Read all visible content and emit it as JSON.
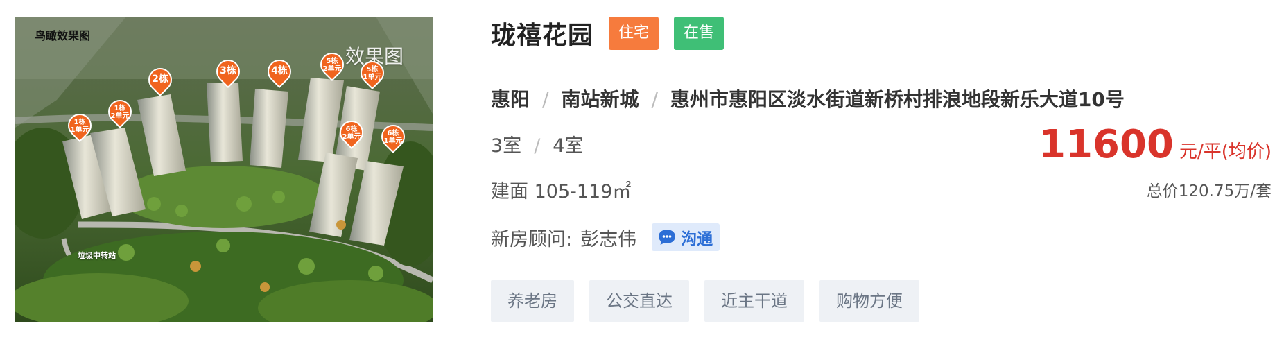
{
  "image": {
    "watermark_top": "鸟瞰效果图",
    "watermark_right": "效果图",
    "watermark_bottom": "垃圾中转站",
    "pins": [
      {
        "line1": "1栋",
        "line2": "1单元"
      },
      {
        "line1": "1栋",
        "line2": "2单元"
      },
      {
        "line1": "2栋",
        "line2": ""
      },
      {
        "line1": "3栋",
        "line2": ""
      },
      {
        "line1": "4栋",
        "line2": ""
      },
      {
        "line1": "5栋",
        "line2": "2单元"
      },
      {
        "line1": "5栋",
        "line2": "1单元"
      },
      {
        "line1": "6栋",
        "line2": "2单元"
      },
      {
        "line1": "6栋",
        "line2": "1单元"
      }
    ]
  },
  "listing": {
    "title": "珑禧花园",
    "tag_type": "住宅",
    "tag_status": "在售",
    "district": "惠阳",
    "area_name": "南站新城",
    "address": "惠州市惠阳区淡水街道新桥村排浪地段新乐大道10号",
    "separator": "/",
    "room_a": "3室",
    "room_b": "4室",
    "size_label": "建面 105-119㎡",
    "agent_label": "新房顾问:",
    "agent_name": "彭志伟",
    "chat_label": "沟通",
    "features": [
      "养老房",
      "公交直达",
      "近主干道",
      "购物方便"
    ]
  },
  "price": {
    "value": "11600",
    "unit": "元/平(均价)",
    "total": "总价120.75万/套"
  },
  "colors": {
    "price_red": "#d9342b",
    "tag_orange": "#f67b3d",
    "tag_green": "#3fbf76",
    "pin_orange": "#f0641e",
    "chat_blue": "#2c6ed6"
  }
}
